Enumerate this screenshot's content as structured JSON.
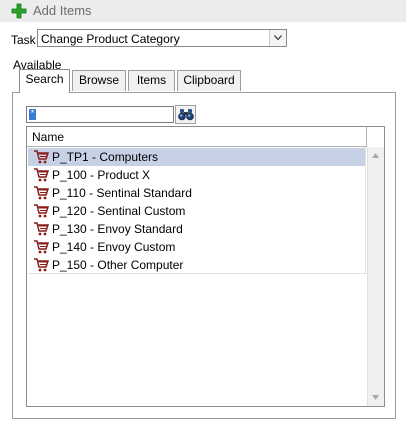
{
  "header": {
    "title": "Add Items",
    "icon": "plus-icon",
    "icon_color": "#2aa52a"
  },
  "task": {
    "label": "Task",
    "selected": "Change Product Category"
  },
  "available_label": "Available",
  "tabs": [
    {
      "label": "Search",
      "active": true
    },
    {
      "label": "Browse",
      "active": false
    },
    {
      "label": "Items",
      "active": false
    },
    {
      "label": "Clipboard",
      "active": false
    }
  ],
  "search": {
    "value": "*"
  },
  "list": {
    "column_header": "Name",
    "items": [
      {
        "label": "P_TP1 - Computers",
        "selected": true
      },
      {
        "label": "P_100 - Product X",
        "selected": false
      },
      {
        "label": "P_110 - Sentinal Standard",
        "selected": false
      },
      {
        "label": "P_120 - Sentinal Custom",
        "selected": false
      },
      {
        "label": "P_130 - Envoy Standard",
        "selected": false
      },
      {
        "label": "P_140 - Envoy Custom",
        "selected": false
      },
      {
        "label": "P_150 - Other Computer",
        "selected": false
      }
    ],
    "item_icon": "shopping-cart-icon",
    "selection_color": "#c6d1e6"
  }
}
